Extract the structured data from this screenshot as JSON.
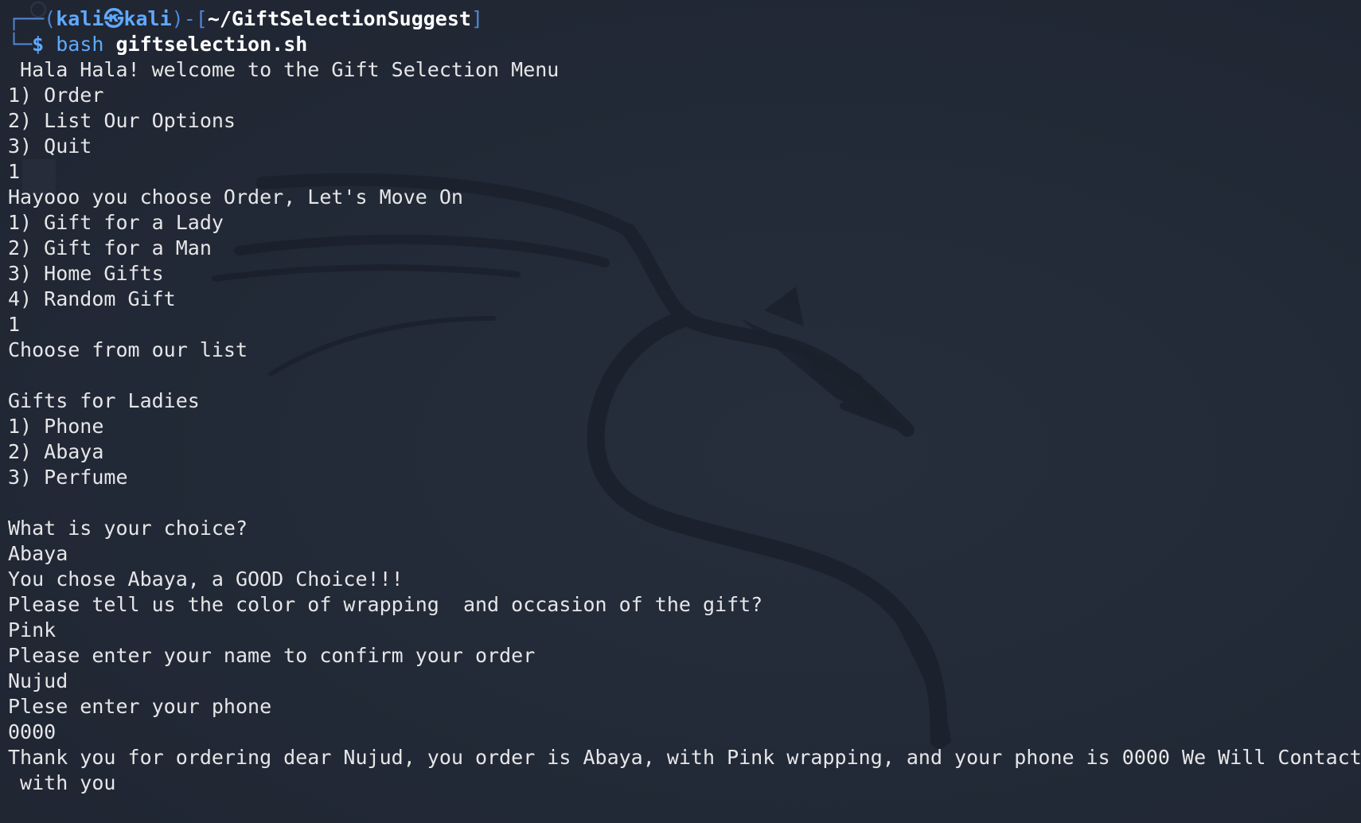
{
  "prompt": {
    "corner_top": "┌──(",
    "user": "kali",
    "at_symbol": "㉿",
    "host": "kali",
    "bracket_mid": ")-[",
    "path": "~/GiftSelectionSuggest",
    "bracket_end": "]",
    "corner_bottom": "└─",
    "dollar": "$ ",
    "command": "bash ",
    "argument": "giftselection.sh"
  },
  "output_lines": [
    " Hala Hala! welcome to the Gift Selection Menu",
    "1) Order",
    "2) List Our Options",
    "3) Quit",
    "1",
    "Hayooo you choose Order, Let's Move On",
    "1) Gift for a Lady",
    "2) Gift for a Man",
    "3) Home Gifts",
    "4) Random Gift",
    "1",
    "Choose from our list",
    "",
    "Gifts for Ladies",
    "1) Phone",
    "2) Abaya",
    "3) Perfume",
    "",
    "What is your choice?",
    "Abaya",
    "You chose Abaya, a GOOD Choice!!!",
    "Please tell us the color of wrapping  and occasion of the gift?",
    "Pink",
    "Please enter your name to confirm your order",
    "Nujud",
    "Plese enter your phone",
    "0000",
    "Thank you for ordering dear Nujud, you order is Abaya, with Pink wrapping, and your phone is 0000 We Will Contact",
    " with you"
  ],
  "colors": {
    "background": "#232a37",
    "prompt_blue": "#5fa9ff",
    "text": "#e6e6e8"
  },
  "icons": {
    "background_logo": "kali-dragon-icon"
  }
}
